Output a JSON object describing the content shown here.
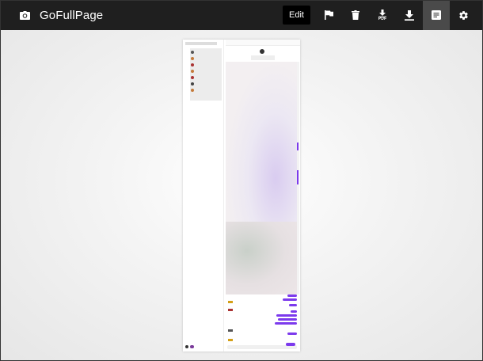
{
  "app": {
    "title": "GoFullPage",
    "camera_icon": "camera-icon"
  },
  "toolbar": {
    "edit_label": "Edit",
    "pdf_label": "PDF",
    "icons": [
      "flag-icon",
      "trash-icon",
      "download-pdf-icon",
      "download-icon",
      "document-icon",
      "gear-icon"
    ]
  },
  "colors": {
    "toolbar_bg": "#1f1f1f",
    "active_bg": "#4a4a4a",
    "accent_purple": "#7c3aed"
  }
}
